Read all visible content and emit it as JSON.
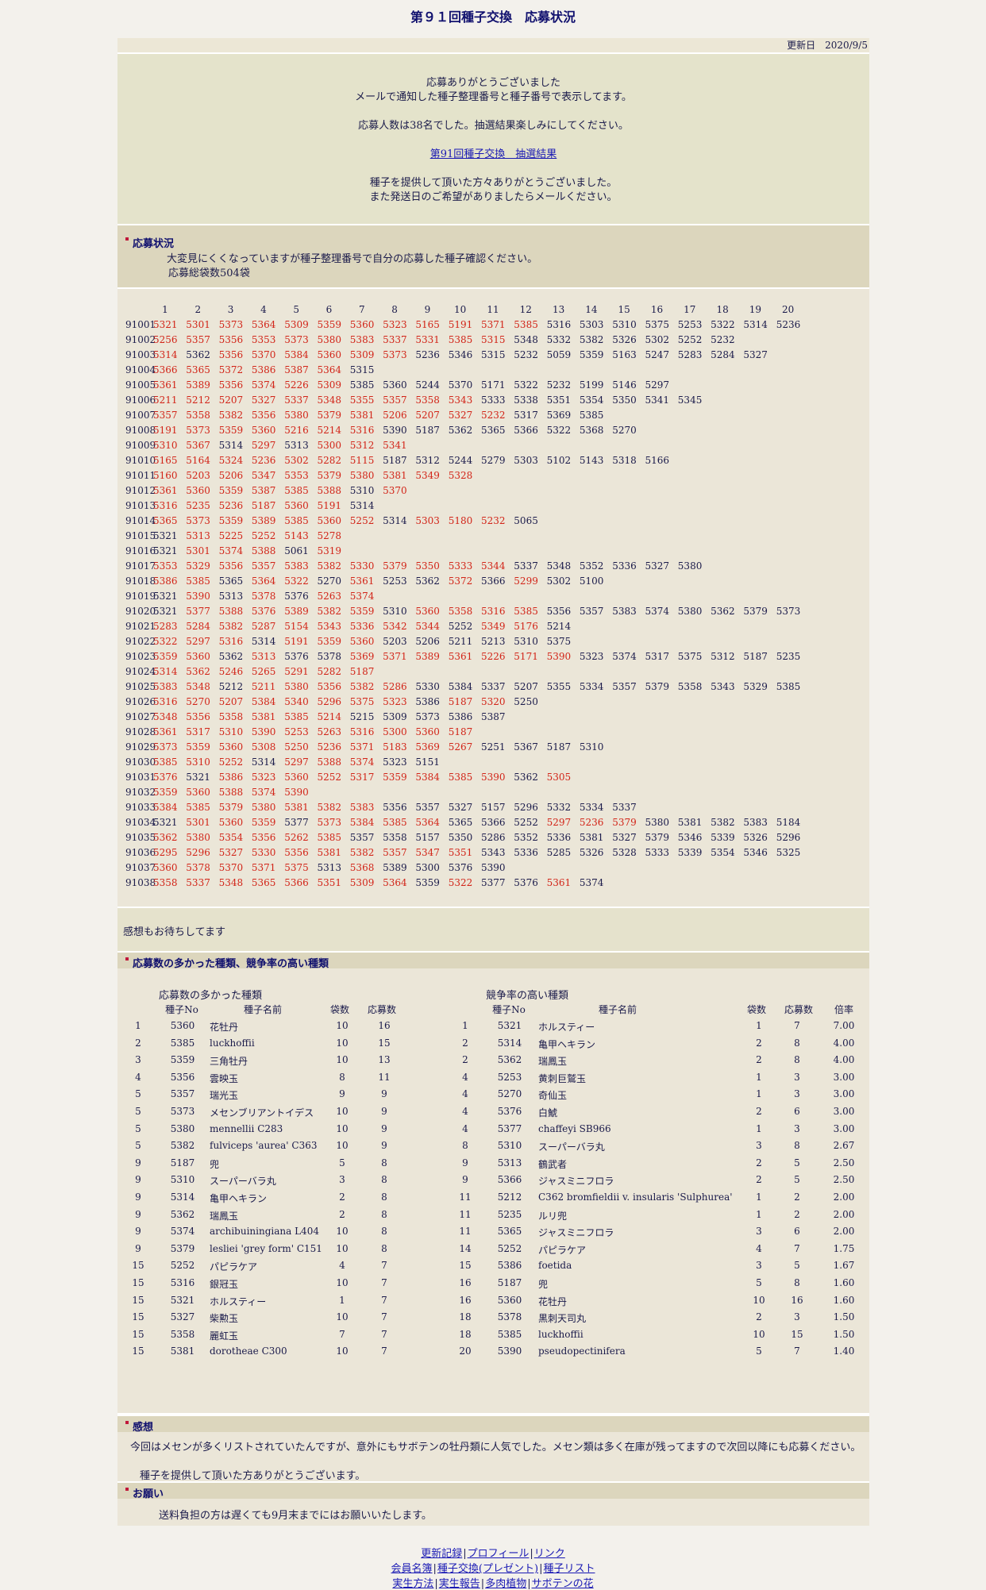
{
  "page_title": "第９１回種子交換　応募状況",
  "updated": "更新日　2020/9/5",
  "intro": {
    "l1": "応募ありがとうございました",
    "l2": "メールで通知した種子整理番号と種子番号で表示してます。",
    "l3": "応募人数は38名でした。抽選結果楽しみにしてください。",
    "link": "第91回種子交換　抽選結果",
    "l4": "種子を提供して頂いた方々ありがとうございました。",
    "l5": "また発送日のご希望がありましたらメールください。"
  },
  "status": {
    "title": "応募状況",
    "l1": "大変見にくくなっていますが種子整理番号で自分の応募した種子確認ください。",
    "l2": "応募総袋数504袋"
  },
  "columns": [
    "1",
    "2",
    "3",
    "4",
    "5",
    "6",
    "7",
    "8",
    "9",
    "10",
    "11",
    "12",
    "13",
    "14",
    "15",
    "16",
    "17",
    "18",
    "19",
    "20"
  ],
  "rows": [
    {
      "id": "91001",
      "v": [
        "5321",
        "5301",
        "5373",
        "5364",
        "5309",
        "5359",
        "5360",
        "5323",
        "5165",
        "5191",
        "5371",
        "5385",
        "5316",
        "5303",
        "5310",
        "5375",
        "5253",
        "5322",
        "5314",
        "5236"
      ],
      "r": 12
    },
    {
      "id": "91002",
      "v": [
        "5256",
        "5357",
        "5356",
        "5353",
        "5373",
        "5380",
        "5383",
        "5337",
        "5331",
        "5385",
        "5315",
        "5348",
        "5332",
        "5382",
        "5326",
        "5302",
        "5252",
        "5232"
      ],
      "r": 11
    },
    {
      "id": "91003",
      "v": [
        "5314",
        "5362",
        "5356",
        "5370",
        "5384",
        "5360",
        "5309",
        "5373",
        "5236",
        "5346",
        "5315",
        "5232",
        "5059",
        "5359",
        "5163",
        "5247",
        "5283",
        "5284",
        "5327"
      ],
      "r": 8,
      "b": [
        1
      ]
    },
    {
      "id": "91004",
      "v": [
        "5366",
        "5365",
        "5372",
        "5386",
        "5387",
        "5364",
        "5315"
      ],
      "r": 6
    },
    {
      "id": "91005",
      "v": [
        "5361",
        "5389",
        "5356",
        "5374",
        "5226",
        "5309",
        "5385",
        "5360",
        "5244",
        "5370",
        "5171",
        "5322",
        "5232",
        "5199",
        "5146",
        "5297"
      ],
      "r": 6
    },
    {
      "id": "91006",
      "v": [
        "5211",
        "5212",
        "5207",
        "5327",
        "5337",
        "5348",
        "5355",
        "5357",
        "5358",
        "5343",
        "5333",
        "5338",
        "5351",
        "5354",
        "5350",
        "5341",
        "5345"
      ],
      "r": 10
    },
    {
      "id": "91007",
      "v": [
        "5357",
        "5358",
        "5382",
        "5356",
        "5380",
        "5379",
        "5381",
        "5206",
        "5207",
        "5327",
        "5232",
        "5317",
        "5369",
        "5385"
      ],
      "r": 11
    },
    {
      "id": "91008",
      "v": [
        "5191",
        "5373",
        "5359",
        "5360",
        "5216",
        "5214",
        "5316",
        "5390",
        "5187",
        "5362",
        "5365",
        "5366",
        "5322",
        "5368",
        "5270"
      ],
      "r": 7
    },
    {
      "id": "91009",
      "v": [
        "5310",
        "5367",
        "5314",
        "5297",
        "5313",
        "5300",
        "5312",
        "5341"
      ],
      "r": 8,
      "b": [
        2,
        4
      ]
    },
    {
      "id": "91010",
      "v": [
        "5165",
        "5164",
        "5324",
        "5236",
        "5302",
        "5282",
        "5115",
        "5187",
        "5312",
        "5244",
        "5279",
        "5303",
        "5102",
        "5143",
        "5318",
        "5166"
      ],
      "r": 7
    },
    {
      "id": "91011",
      "v": [
        "5160",
        "5203",
        "5206",
        "5347",
        "5353",
        "5379",
        "5380",
        "5381",
        "5349",
        "5328"
      ],
      "r": 10
    },
    {
      "id": "91012",
      "v": [
        "5361",
        "5360",
        "5359",
        "5387",
        "5385",
        "5388",
        "5310",
        "5370"
      ],
      "r": 8,
      "b": [
        6
      ]
    },
    {
      "id": "91013",
      "v": [
        "5316",
        "5235",
        "5236",
        "5187",
        "5360",
        "5191",
        "5314"
      ],
      "r": 6
    },
    {
      "id": "91014",
      "v": [
        "5365",
        "5373",
        "5359",
        "5389",
        "5385",
        "5360",
        "5252",
        "5314",
        "5303",
        "5180",
        "5232",
        "5065"
      ],
      "r": 11,
      "b": [
        7
      ]
    },
    {
      "id": "91015",
      "v": [
        "5321",
        "5313",
        "5225",
        "5252",
        "5143",
        "5278"
      ],
      "r": 6,
      "b": [
        0
      ]
    },
    {
      "id": "91016",
      "v": [
        "5321",
        "5301",
        "5374",
        "5388",
        "5061",
        "5319"
      ],
      "r": 6,
      "b": [
        0,
        4
      ]
    },
    {
      "id": "91017",
      "v": [
        "5353",
        "5329",
        "5356",
        "5357",
        "5383",
        "5382",
        "5330",
        "5379",
        "5350",
        "5333",
        "5344",
        "5337",
        "5348",
        "5352",
        "5336",
        "5327",
        "5380"
      ],
      "r": 11
    },
    {
      "id": "91018",
      "v": [
        "5386",
        "5385",
        "5365",
        "5364",
        "5322",
        "5270",
        "5361",
        "5253",
        "5362",
        "5372",
        "5366",
        "5299",
        "5302",
        "5100"
      ],
      "r": 12,
      "b": [
        2,
        5,
        7,
        8,
        10
      ]
    },
    {
      "id": "91019",
      "v": [
        "5321",
        "5390",
        "5313",
        "5378",
        "5376",
        "5263",
        "5374"
      ],
      "r": 7,
      "b": [
        0,
        2,
        4
      ]
    },
    {
      "id": "91020",
      "v": [
        "5321",
        "5377",
        "5388",
        "5376",
        "5389",
        "5382",
        "5359",
        "5310",
        "5360",
        "5358",
        "5316",
        "5385",
        "5356",
        "5357",
        "5383",
        "5374",
        "5380",
        "5362",
        "5379",
        "5373"
      ],
      "r": 12,
      "b": [
        0,
        7
      ]
    },
    {
      "id": "91021",
      "v": [
        "5283",
        "5284",
        "5382",
        "5287",
        "5154",
        "5343",
        "5336",
        "5342",
        "5344",
        "5252",
        "5349",
        "5176",
        "5214"
      ],
      "r": 12,
      "b": [
        9
      ]
    },
    {
      "id": "91022",
      "v": [
        "5322",
        "5297",
        "5316",
        "5314",
        "5191",
        "5359",
        "5360",
        "5203",
        "5206",
        "5211",
        "5213",
        "5310",
        "5375"
      ],
      "r": 7,
      "b": [
        3
      ]
    },
    {
      "id": "91023",
      "v": [
        "5359",
        "5360",
        "5362",
        "5313",
        "5376",
        "5378",
        "5369",
        "5371",
        "5389",
        "5361",
        "5226",
        "5171",
        "5390",
        "5323",
        "5374",
        "5317",
        "5375",
        "5312",
        "5187",
        "5235"
      ],
      "r": 13,
      "b": [
        2,
        4,
        5
      ]
    },
    {
      "id": "91024",
      "v": [
        "5314",
        "5362",
        "5246",
        "5265",
        "5291",
        "5282",
        "5187"
      ],
      "r": 7
    },
    {
      "id": "91025",
      "v": [
        "5383",
        "5348",
        "5212",
        "5211",
        "5380",
        "5356",
        "5382",
        "5286",
        "5330",
        "5384",
        "5337",
        "5207",
        "5355",
        "5334",
        "5357",
        "5379",
        "5358",
        "5343",
        "5329",
        "5385"
      ],
      "r": 8,
      "b": [
        2
      ]
    },
    {
      "id": "91026",
      "v": [
        "5316",
        "5270",
        "5207",
        "5384",
        "5340",
        "5296",
        "5375",
        "5323",
        "5386",
        "5187",
        "5320",
        "5250"
      ],
      "r": 11,
      "b": [
        8
      ]
    },
    {
      "id": "91027",
      "v": [
        "5348",
        "5356",
        "5358",
        "5381",
        "5385",
        "5214",
        "5215",
        "5309",
        "5373",
        "5386",
        "5387"
      ],
      "r": 6
    },
    {
      "id": "91028",
      "v": [
        "5361",
        "5317",
        "5310",
        "5390",
        "5253",
        "5263",
        "5316",
        "5300",
        "5360",
        "5187"
      ],
      "r": 10
    },
    {
      "id": "91029",
      "v": [
        "5373",
        "5359",
        "5360",
        "5308",
        "5250",
        "5236",
        "5371",
        "5183",
        "5369",
        "5267",
        "5251",
        "5367",
        "5187",
        "5310"
      ],
      "r": 10
    },
    {
      "id": "91030",
      "v": [
        "5385",
        "5310",
        "5252",
        "5314",
        "5297",
        "5388",
        "5374",
        "5323",
        "5151"
      ],
      "r": 7,
      "b": [
        3
      ]
    },
    {
      "id": "91031",
      "v": [
        "5376",
        "5321",
        "5386",
        "5323",
        "5360",
        "5252",
        "5317",
        "5359",
        "5384",
        "5385",
        "5390",
        "5362",
        "5305"
      ],
      "r": 13,
      "b": [
        1,
        11
      ]
    },
    {
      "id": "91032",
      "v": [
        "5359",
        "5360",
        "5388",
        "5374",
        "5390"
      ],
      "r": 5
    },
    {
      "id": "91033",
      "v": [
        "5384",
        "5385",
        "5379",
        "5380",
        "5381",
        "5382",
        "5383",
        "5356",
        "5357",
        "5327",
        "5157",
        "5296",
        "5332",
        "5334",
        "5337"
      ],
      "r": 7
    },
    {
      "id": "91034",
      "v": [
        "5321",
        "5301",
        "5360",
        "5359",
        "5377",
        "5373",
        "5384",
        "5385",
        "5364",
        "5365",
        "5366",
        "5252",
        "5297",
        "5236",
        "5379",
        "5380",
        "5381",
        "5382",
        "5383",
        "5184"
      ],
      "r": 15,
      "b": [
        0,
        4,
        9,
        10,
        11
      ]
    },
    {
      "id": "91035",
      "v": [
        "5362",
        "5380",
        "5354",
        "5356",
        "5262",
        "5385",
        "5357",
        "5358",
        "5157",
        "5350",
        "5286",
        "5352",
        "5336",
        "5381",
        "5327",
        "5379",
        "5346",
        "5339",
        "5326",
        "5296"
      ],
      "r": 6
    },
    {
      "id": "91036",
      "v": [
        "5295",
        "5296",
        "5327",
        "5330",
        "5356",
        "5381",
        "5382",
        "5357",
        "5347",
        "5351",
        "5343",
        "5336",
        "5285",
        "5326",
        "5328",
        "5333",
        "5339",
        "5354",
        "5346",
        "5325"
      ],
      "r": 10
    },
    {
      "id": "91037",
      "v": [
        "5360",
        "5378",
        "5370",
        "5371",
        "5375",
        "5313",
        "5368",
        "5389",
        "5300",
        "5376",
        "5390"
      ],
      "r": 7,
      "b": [
        5
      ]
    },
    {
      "id": "91038",
      "v": [
        "5358",
        "5337",
        "5348",
        "5365",
        "5366",
        "5351",
        "5309",
        "5364",
        "5359",
        "5322",
        "5377",
        "5376",
        "5361",
        "5374"
      ],
      "r": 13,
      "b": [
        8,
        10,
        11
      ]
    }
  ],
  "kanso_wait": "感想もお待ちしてます",
  "ranking_title": "応募数の多かった種類、競争率の高い種類",
  "left_table": {
    "caption": "応募数の多かった種類",
    "headers": [
      "種子No",
      "種子名前",
      "袋数",
      "応募数"
    ],
    "rows": [
      [
        "1",
        "5360",
        "花牡丹",
        "10",
        "16"
      ],
      [
        "2",
        "5385",
        "luckhoffii",
        "10",
        "15"
      ],
      [
        "3",
        "5359",
        "三角牡丹",
        "10",
        "13"
      ],
      [
        "4",
        "5356",
        "雲映玉",
        "8",
        "11"
      ],
      [
        "5",
        "5357",
        "瑞光玉",
        "9",
        "9"
      ],
      [
        "5",
        "5373",
        "メセンブリアントイデス",
        "10",
        "9"
      ],
      [
        "5",
        "5380",
        "mennellii C283",
        "10",
        "9"
      ],
      [
        "5",
        "5382",
        "fulviceps 'aurea' C363",
        "10",
        "9"
      ],
      [
        "9",
        "5187",
        "兜",
        "5",
        "8"
      ],
      [
        "9",
        "5310",
        "スーパーバラ丸",
        "3",
        "8"
      ],
      [
        "9",
        "5314",
        "亀甲ヘキラン",
        "2",
        "8"
      ],
      [
        "9",
        "5362",
        "瑞鳳玉",
        "2",
        "8"
      ],
      [
        "9",
        "5374",
        "archibuiningiana L404",
        "10",
        "8"
      ],
      [
        "9",
        "5379",
        "lesliei 'grey form' C151",
        "10",
        "8"
      ],
      [
        "15",
        "5252",
        "パピラケア",
        "4",
        "7"
      ],
      [
        "15",
        "5316",
        "銀冠玉",
        "10",
        "7"
      ],
      [
        "15",
        "5321",
        "ホルスティー",
        "1",
        "7"
      ],
      [
        "15",
        "5327",
        "柴勲玉",
        "10",
        "7"
      ],
      [
        "15",
        "5358",
        "麗虹玉",
        "7",
        "7"
      ],
      [
        "15",
        "5381",
        "dorotheae C300",
        "10",
        "7"
      ]
    ]
  },
  "right_table": {
    "caption": "競争率の高い種類",
    "headers": [
      "種子No",
      "種子名前",
      "袋数",
      "応募数",
      "倍率"
    ],
    "rows": [
      [
        "1",
        "5321",
        "ホルスティー",
        "1",
        "7",
        "7.00"
      ],
      [
        "2",
        "5314",
        "亀甲ヘキラン",
        "2",
        "8",
        "4.00"
      ],
      [
        "2",
        "5362",
        "瑞鳳玉",
        "2",
        "8",
        "4.00"
      ],
      [
        "4",
        "5253",
        "黄刺巨鷲玉",
        "1",
        "3",
        "3.00"
      ],
      [
        "4",
        "5270",
        "奇仙玉",
        "1",
        "3",
        "3.00"
      ],
      [
        "4",
        "5376",
        "白鯱",
        "2",
        "6",
        "3.00"
      ],
      [
        "4",
        "5377",
        "chaffeyi SB966",
        "1",
        "3",
        "3.00"
      ],
      [
        "8",
        "5310",
        "スーパーバラ丸",
        "3",
        "8",
        "2.67"
      ],
      [
        "9",
        "5313",
        "鶴武者",
        "2",
        "5",
        "2.50"
      ],
      [
        "9",
        "5366",
        "ジャスミニフロラ",
        "2",
        "5",
        "2.50"
      ],
      [
        "11",
        "5212",
        "C362 bromfieldii v. insularis 'Sulphurea'",
        "1",
        "2",
        "2.00"
      ],
      [
        "11",
        "5235",
        "ルリ兜",
        "1",
        "2",
        "2.00"
      ],
      [
        "11",
        "5365",
        "ジャスミニフロラ",
        "3",
        "6",
        "2.00"
      ],
      [
        "14",
        "5252",
        "パピラケア",
        "4",
        "7",
        "1.75"
      ],
      [
        "15",
        "5386",
        "foetida",
        "3",
        "5",
        "1.67"
      ],
      [
        "16",
        "5187",
        "兜",
        "5",
        "8",
        "1.60"
      ],
      [
        "16",
        "5360",
        "花牡丹",
        "10",
        "16",
        "1.60"
      ],
      [
        "18",
        "5378",
        "黒刺天司丸",
        "2",
        "3",
        "1.50"
      ],
      [
        "18",
        "5385",
        "luckhoffii",
        "10",
        "15",
        "1.50"
      ],
      [
        "20",
        "5390",
        "pseudopectinifera",
        "5",
        "7",
        "1.40"
      ]
    ]
  },
  "kanso": {
    "title": "感想",
    "l1": "今回はメセンが多くリストされていたんですが、意外にもサボテンの牡丹類に人気でした。メセン類は多く在庫が残ってますので次回以降にも応募ください。",
    "l2": "種子を提供して頂いた方ありがとうございます。"
  },
  "request": {
    "title": "お願い",
    "l1": "送料負担の方は遅くても9月末までにはお願いいたします。"
  },
  "footer": {
    "r1": [
      "更新記録",
      "プロフィール",
      "リンク"
    ],
    "r2": [
      "会員名簿",
      "種子交換(プレゼント)",
      "種子リスト"
    ],
    "r3": [
      "実生方法",
      "実生報告",
      "多肉植物",
      "サボテンの花"
    ]
  }
}
